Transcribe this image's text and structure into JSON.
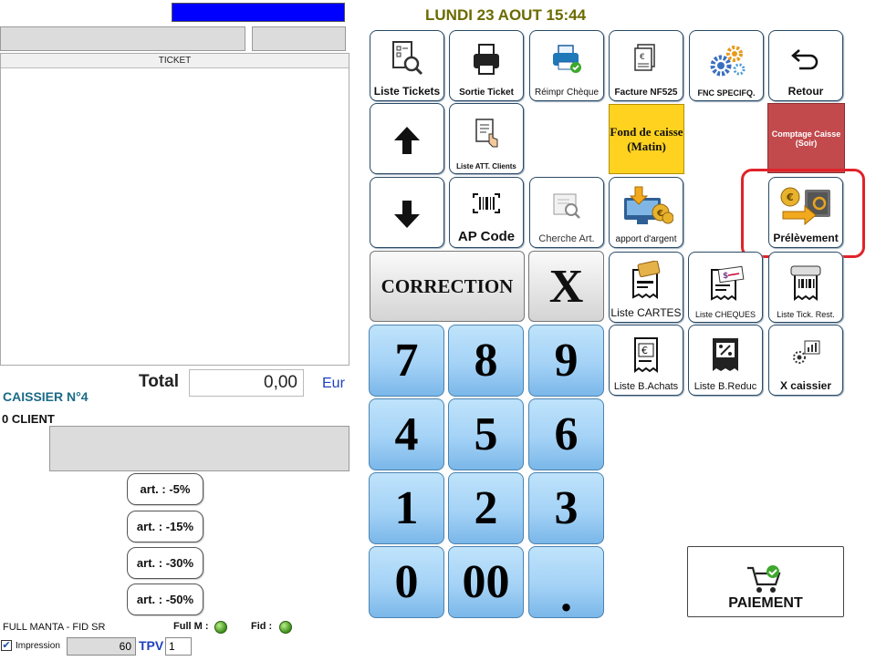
{
  "header": {
    "date": "LUNDI 23 AOUT 15:44"
  },
  "ticket": {
    "title": "TICKET"
  },
  "totals": {
    "label": "Total",
    "value": "0,00",
    "currency": "Eur"
  },
  "cashier": {
    "name": "CAISSIER N°4",
    "clients": "0 CLIENT"
  },
  "discounts": [
    "art. : -5%",
    "art. : -15%",
    "art. : -30%",
    "art. : -50%"
  ],
  "footer": {
    "mode": "FULL MANTA - FID SR",
    "full_m": "Full M :",
    "fid": "Fid :",
    "impression": "Impression",
    "print_value": "60",
    "tpv_label": "TPV",
    "tpv_value": "1"
  },
  "tiles": {
    "liste_tickets": "Liste Tickets",
    "sortie_ticket": "Sortie Ticket",
    "reimpr_cheque": "Réimpr Chèque",
    "facture": "Facture NF525",
    "fnc": "FNC SPECIFQ.",
    "retour": "Retour",
    "liste_att": "Liste ATT. Clients",
    "fond_de_caisse": "Fond de caisse (Matin)",
    "comptage": "Comptage Caisse (Soir)",
    "ap_code": "AP Code",
    "cherche_art": "Cherche Art.",
    "apport": "apport d'argent",
    "prelevement": "Prélèvement",
    "liste_cartes": "Liste CARTES",
    "liste_cheques": "Liste CHEQUES",
    "liste_tick_rest": "Liste Tick. Rest.",
    "liste_b_achats": "Liste B.Achats",
    "liste_b_reduc": "Liste B.Reduc",
    "x_caissier": "X caissier",
    "paiement": "PAIEMENT"
  },
  "keypad": {
    "correction": "CORRECTION",
    "clear": "X",
    "keys": [
      "7",
      "8",
      "9",
      "4",
      "5",
      "6",
      "1",
      "2",
      "3",
      "0",
      "00",
      "."
    ]
  },
  "colors": {
    "accent_blue": "#0000ff",
    "fond_yellow": "#ffd21f",
    "comptage_red": "#c24a4d",
    "highlight_red": "#e0232a",
    "key_blue": "#a4d2f6"
  }
}
